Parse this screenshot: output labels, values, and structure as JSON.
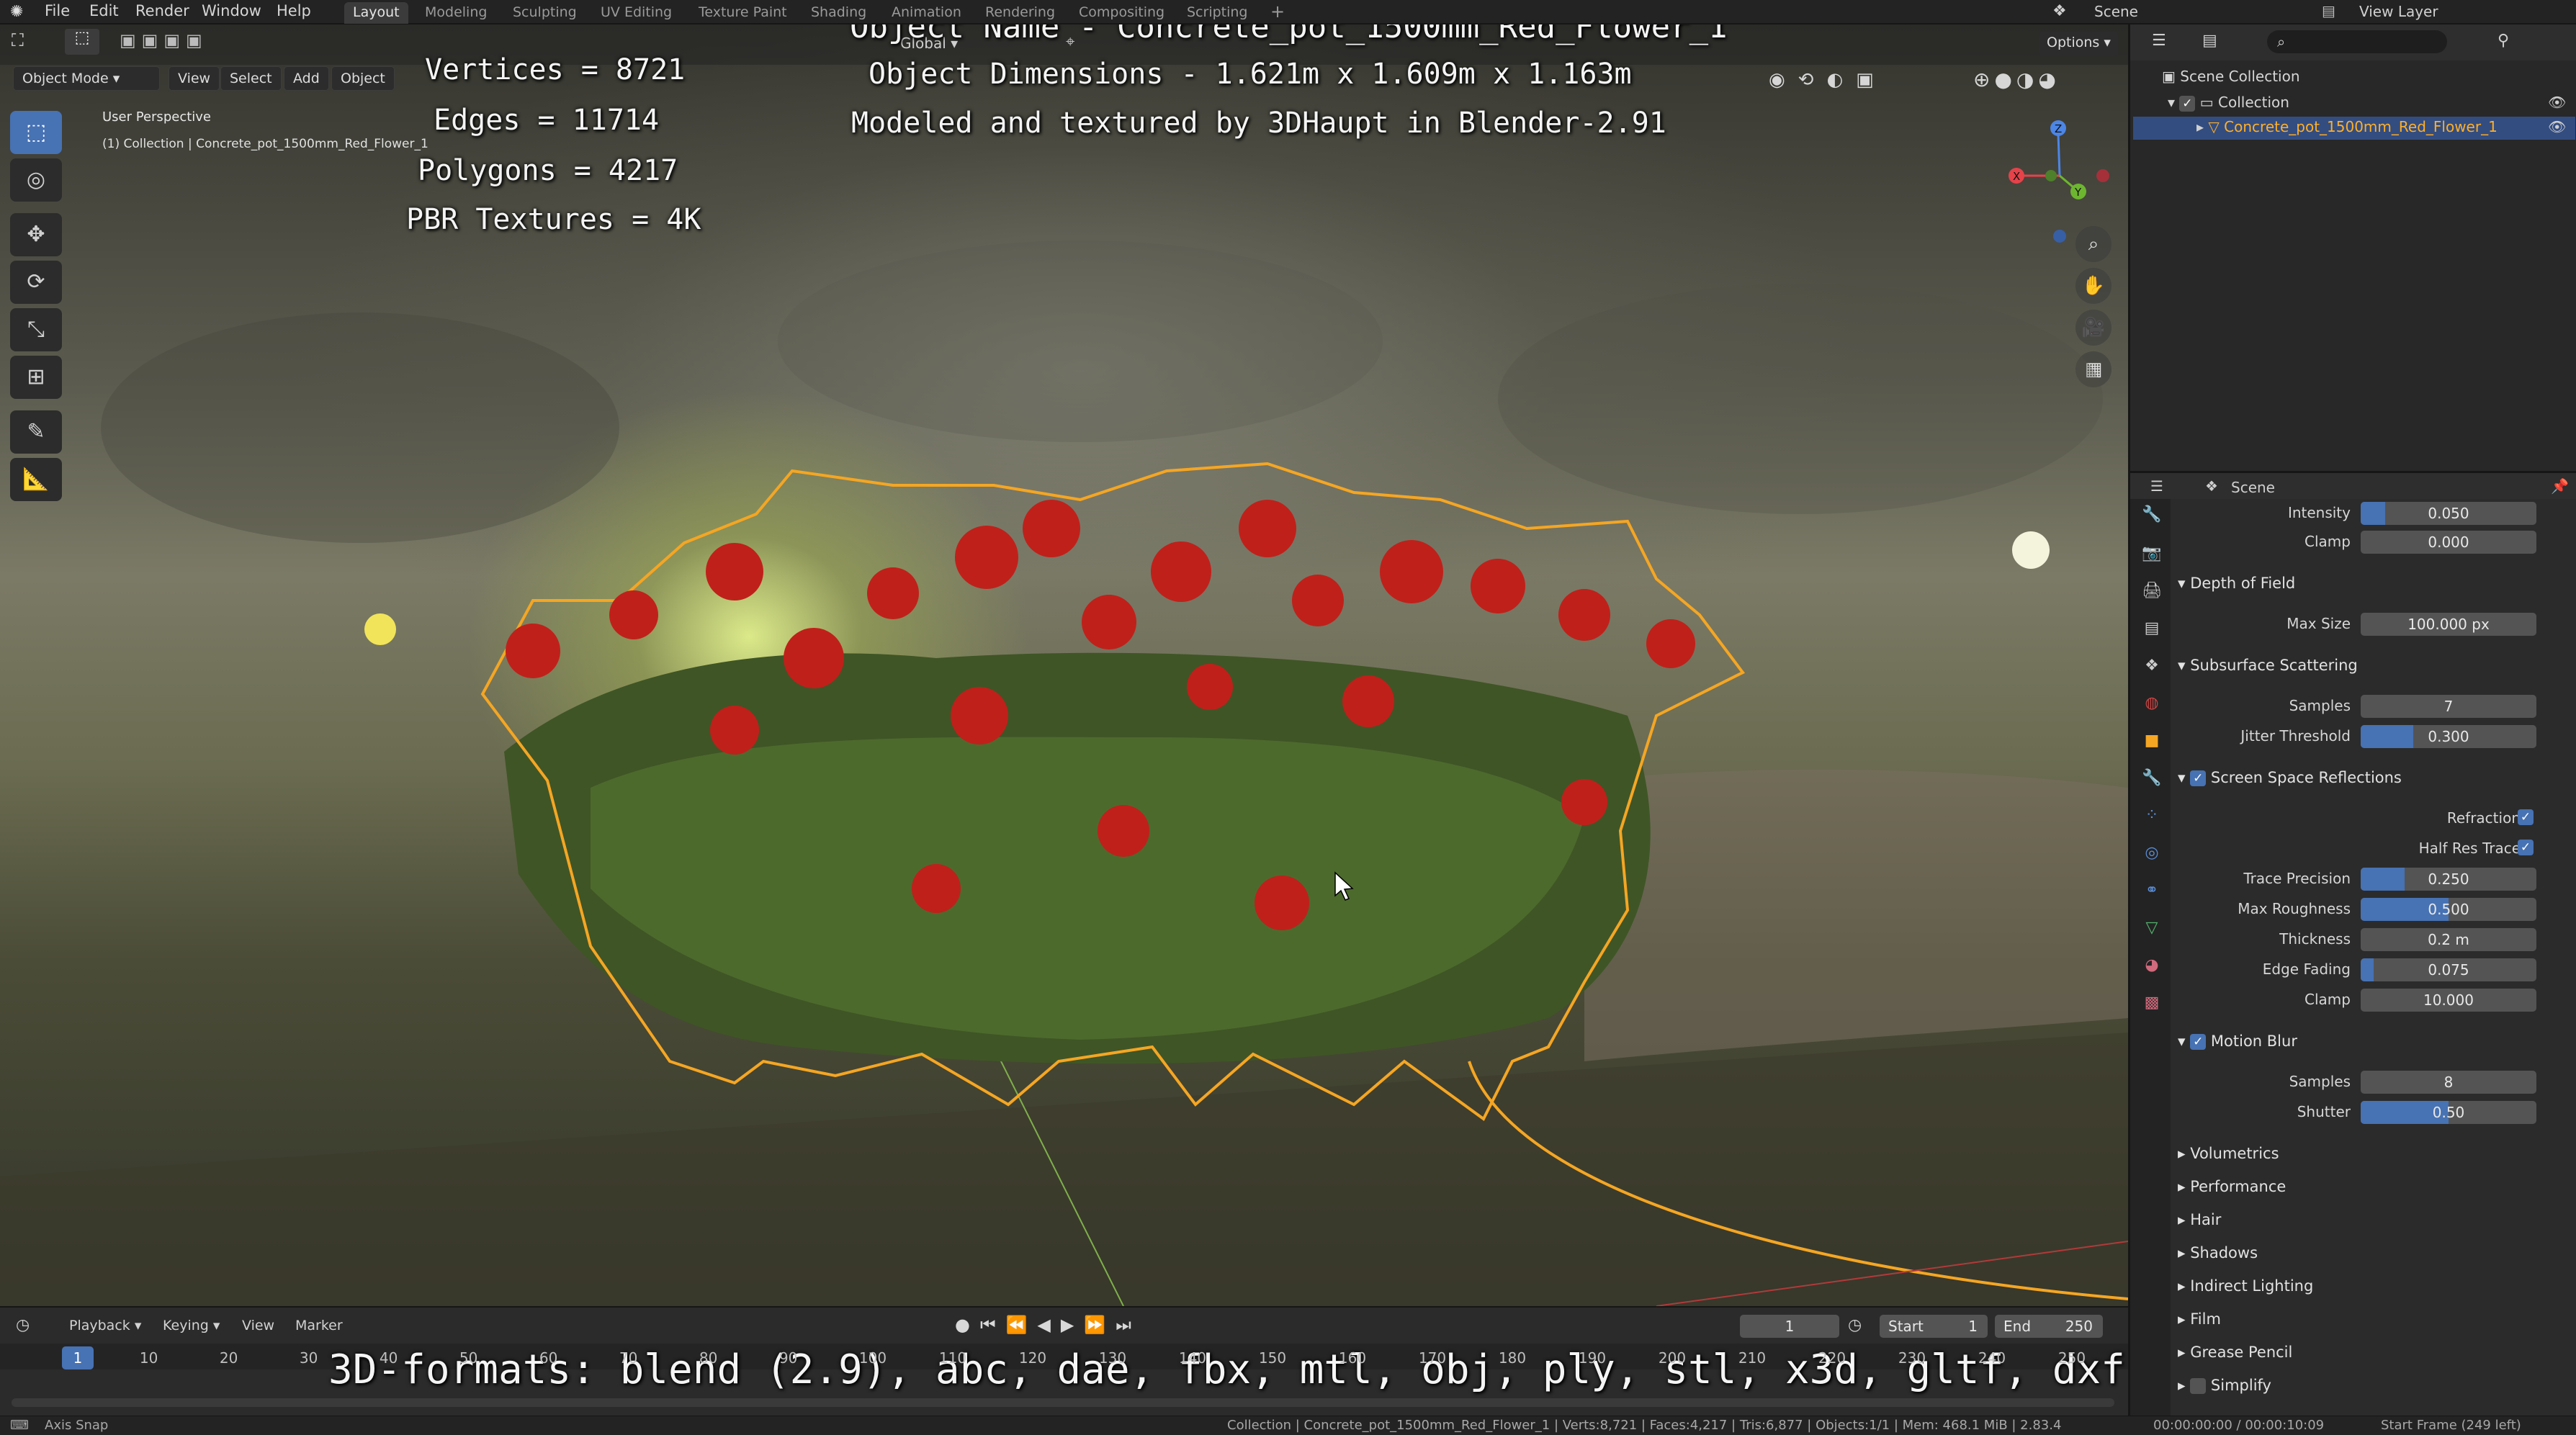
{
  "menu": [
    "File",
    "Edit",
    "Render",
    "Window",
    "Help"
  ],
  "workspaces": [
    "Layout",
    "Modeling",
    "Sculpting",
    "UV Editing",
    "Texture Paint",
    "Shading",
    "Animation",
    "Rendering",
    "Compositing",
    "Scripting"
  ],
  "topbar_right": {
    "scene": "Scene",
    "view_layer": "View Layer"
  },
  "viewport_header": {
    "mode": "Object Mode",
    "view": "View",
    "select": "Select",
    "add": "Add",
    "object": "Object",
    "transform": "Global",
    "options": "Options"
  },
  "viewport_info": {
    "perspective": "User Perspective",
    "collection": "(1) Collection | Concrete_pot_1500mm_Red_Flower_1"
  },
  "overlay": {
    "stats": [
      "Vertices = 8721",
      "Edges = 11714",
      "Polygons = 4217",
      "PBR Textures = 4K"
    ],
    "title": "Object Name - Concrete_pot_1500mm_Red_Flower_1",
    "dimensions": "Object Dimensions -  1.621m x 1.609m x 1.163m",
    "credit": "Modeled and textured by 3DHaupt in Blender-2.91",
    "formats": "3D-formats: blend (2.9), abc, dae, fbx, mtl, obj, ply, stl, x3d, gltf, dxf"
  },
  "tools": [
    "select-box",
    "cursor",
    "move",
    "rotate",
    "scale",
    "transform",
    "annotate",
    "measure"
  ],
  "nav_gizmo": {
    "x": "X",
    "y": "Y",
    "z": "Z"
  },
  "timeline": {
    "playback": "Playback",
    "keying": "Keying",
    "view": "View",
    "marker": "Marker",
    "current_frame": "1",
    "start_label": "Start",
    "start": "1",
    "end_label": "End",
    "end": "250",
    "frame_ticks": [
      "1",
      "10",
      "20",
      "30",
      "40",
      "50",
      "60",
      "70",
      "80",
      "90",
      "100",
      "110",
      "120",
      "130",
      "140",
      "150",
      "160",
      "170",
      "180",
      "190",
      "200",
      "210",
      "220",
      "230",
      "240",
      "250"
    ]
  },
  "statusbar": {
    "left": "Axis Snap",
    "center": "Collection | Concrete_pot_1500mm_Red_Flower_1 | Verts:8,721 | Faces:4,217 | Tris:6,877 | Objects:1/1 | Mem: 468.1 MiB | 2.83.4",
    "time": "00:00:00:00 / 00:00:10:09",
    "right": "Start Frame (249 left)"
  },
  "outliner": {
    "root": "Scene Collection",
    "collection": "Collection",
    "object": "Concrete_pot_1500mm_Red_Flower_1"
  },
  "properties": {
    "context": "Scene",
    "rows": {
      "intensity_label": "Intensity",
      "intensity": "0.050",
      "clamp_label": "Clamp",
      "clamp": "0.000"
    },
    "dof": {
      "title": "Depth of Field",
      "max_size_label": "Max Size",
      "max_size": "100.000 px"
    },
    "sss": {
      "title": "Subsurface Scattering",
      "samples_label": "Samples",
      "samples": "7",
      "jitter_label": "Jitter Threshold",
      "jitter": "0.300",
      "jitter_level": 0.3
    },
    "ssr": {
      "title": "Screen Space Reflections",
      "refraction_label": "Refraction",
      "half_res_label": "Half Res Trace",
      "trace_precision_label": "Trace Precision",
      "trace_precision": "0.250",
      "trace_precision_level": 0.25,
      "max_roughness_label": "Max Roughness",
      "max_roughness": "0.500",
      "max_roughness_level": 0.5,
      "thickness_label": "Thickness",
      "thickness": "0.2 m",
      "edge_fading_label": "Edge Fading",
      "edge_fading": "0.075",
      "edge_fading_level": 0.075,
      "clamp_label": "Clamp",
      "clamp": "10.000"
    },
    "motion_blur": {
      "title": "Motion Blur",
      "samples_label": "Samples",
      "samples": "8",
      "shutter_label": "Shutter",
      "shutter": "0.50",
      "shutter_level": 0.5
    },
    "collapsed": [
      "Volumetrics",
      "Performance",
      "Hair",
      "Shadows",
      "Indirect Lighting",
      "Film",
      "Grease Pencil",
      "Simplify"
    ]
  },
  "colors": {
    "accent": "#4772b3",
    "selection": "#f5a623",
    "flower_red": "#c0201a"
  }
}
